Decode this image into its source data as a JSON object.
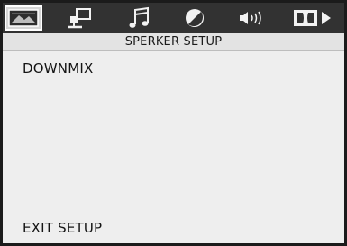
{
  "tabs": [
    {
      "icon": "tv-picture-icon",
      "active": true
    },
    {
      "icon": "speaker-stand-icon",
      "active": false
    },
    {
      "icon": "music-note-icon",
      "active": false
    },
    {
      "icon": "color-contrast-icon",
      "active": false
    },
    {
      "icon": "volume-speaker-icon",
      "active": false
    },
    {
      "icon": "dolby-digital-icon",
      "active": false
    }
  ],
  "title": "SPERKER SETUP",
  "menu": {
    "downmix": "DOWNMIX",
    "exit": "EXIT SETUP"
  },
  "colors": {
    "tab_bar": "#323232",
    "panel": "#eeeeee",
    "border": "#1b1b1b",
    "icon": "#f2f2f2",
    "active_tab": "#d6d6d6"
  }
}
